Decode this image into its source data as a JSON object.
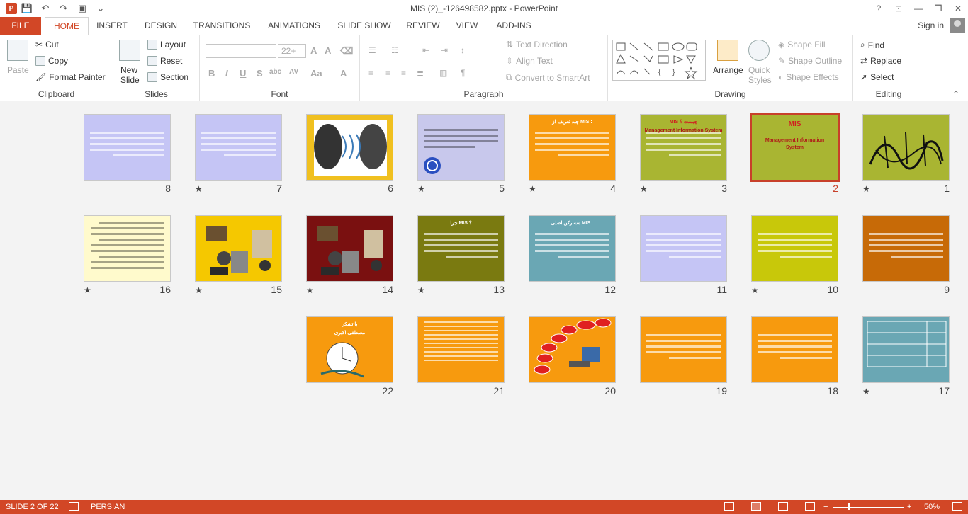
{
  "window": {
    "title": "MIS (2)_-126498582.pptx - PowerPoint",
    "help": "?",
    "minimize": "—",
    "maximize": "❐",
    "close": "✕",
    "restore_ribbon": "⊡"
  },
  "tabs": [
    "FILE",
    "HOME",
    "INSERT",
    "DESIGN",
    "TRANSITIONS",
    "ANIMATIONS",
    "SLIDE SHOW",
    "REVIEW",
    "VIEW",
    "ADD-INS"
  ],
  "signin": "Sign in",
  "ribbon": {
    "clipboard": {
      "label": "Clipboard",
      "paste": "Paste",
      "cut": "Cut",
      "copy": "Copy",
      "format_painter": "Format Painter"
    },
    "slides": {
      "label": "Slides",
      "new_slide": "New\nSlide",
      "layout": "Layout",
      "reset": "Reset",
      "section": "Section"
    },
    "font": {
      "label": "Font",
      "size": "22+",
      "bold": "B",
      "italic": "I",
      "underline": "U",
      "shadow": "S",
      "strike": "abc",
      "spacing": "AV",
      "case": "Aa",
      "color": "A"
    },
    "paragraph": {
      "label": "Paragraph",
      "text_direction": "Text Direction",
      "align_text": "Align Text",
      "smartart": "Convert to SmartArt"
    },
    "drawing": {
      "label": "Drawing",
      "arrange": "Arrange",
      "quick_styles": "Quick\nStyles",
      "shape_fill": "Shape Fill",
      "shape_outline": "Shape Outline",
      "shape_effects": "Shape Effects"
    },
    "editing": {
      "label": "Editing",
      "find": "Find",
      "replace": "Replace",
      "select": "Select"
    }
  },
  "slides": [
    {
      "n": "1",
      "star": "★",
      "bg": "#a9b532",
      "kind": "calligraphy"
    },
    {
      "n": "2",
      "star": "",
      "bg": "#a9b532",
      "kind": "title",
      "title": "MIS",
      "sub": "Management Information\nSystem",
      "selected": true
    },
    {
      "n": "3",
      "star": "★",
      "bg": "#a9b532",
      "kind": "text",
      "title": "MIS چیست ؟",
      "sub": "Management Information System"
    },
    {
      "n": "4",
      "star": "★",
      "bg": "#f79a0e",
      "kind": "text",
      "title": "چند تعریف از MIS :"
    },
    {
      "n": "5",
      "star": "★",
      "bg": "#c8c8ec",
      "kind": "swirl"
    },
    {
      "n": "6",
      "star": "",
      "bg": "#f0c020",
      "kind": "faces"
    },
    {
      "n": "7",
      "star": "★",
      "bg": "#c5c5f5",
      "kind": "text"
    },
    {
      "n": "8",
      "star": "",
      "bg": "#c5c5f5",
      "kind": "text"
    },
    {
      "n": "9",
      "star": "",
      "bg": "#c76a07",
      "kind": "text"
    },
    {
      "n": "10",
      "star": "★",
      "bg": "#c8c80a",
      "kind": "text"
    },
    {
      "n": "11",
      "star": "",
      "bg": "#c5c5f5",
      "kind": "text"
    },
    {
      "n": "12",
      "star": "",
      "bg": "#6aa7b4",
      "kind": "text",
      "title": "سه رکن اصلی MIS :"
    },
    {
      "n": "13",
      "star": "★",
      "bg": "#7a7a10",
      "kind": "text",
      "title": "چرا MIS ؟"
    },
    {
      "n": "14",
      "star": "★",
      "bg": "#7a1010",
      "kind": "clip"
    },
    {
      "n": "15",
      "star": "★",
      "bg": "#f5c800",
      "kind": "clip"
    },
    {
      "n": "16",
      "star": "★",
      "bg": "#fffacc",
      "kind": "darktext"
    },
    {
      "n": "17",
      "star": "★",
      "bg": "#6aa7b4",
      "kind": "table"
    },
    {
      "n": "18",
      "star": "",
      "bg": "#f79a0e",
      "kind": "text"
    },
    {
      "n": "19",
      "star": "",
      "bg": "#f79a0e",
      "kind": "text"
    },
    {
      "n": "20",
      "star": "",
      "bg": "#f79a0e",
      "kind": "pyramid"
    },
    {
      "n": "21",
      "star": "",
      "bg": "#f79a0e",
      "kind": "list"
    },
    {
      "n": "22",
      "star": "",
      "bg": "#f79a0e",
      "kind": "thanks",
      "title": "با تشکر",
      "sub": "مصطفی اکبری"
    }
  ],
  "status": {
    "slide": "SLIDE 2 OF 22",
    "language": "PERSIAN",
    "zoom": "50%"
  }
}
